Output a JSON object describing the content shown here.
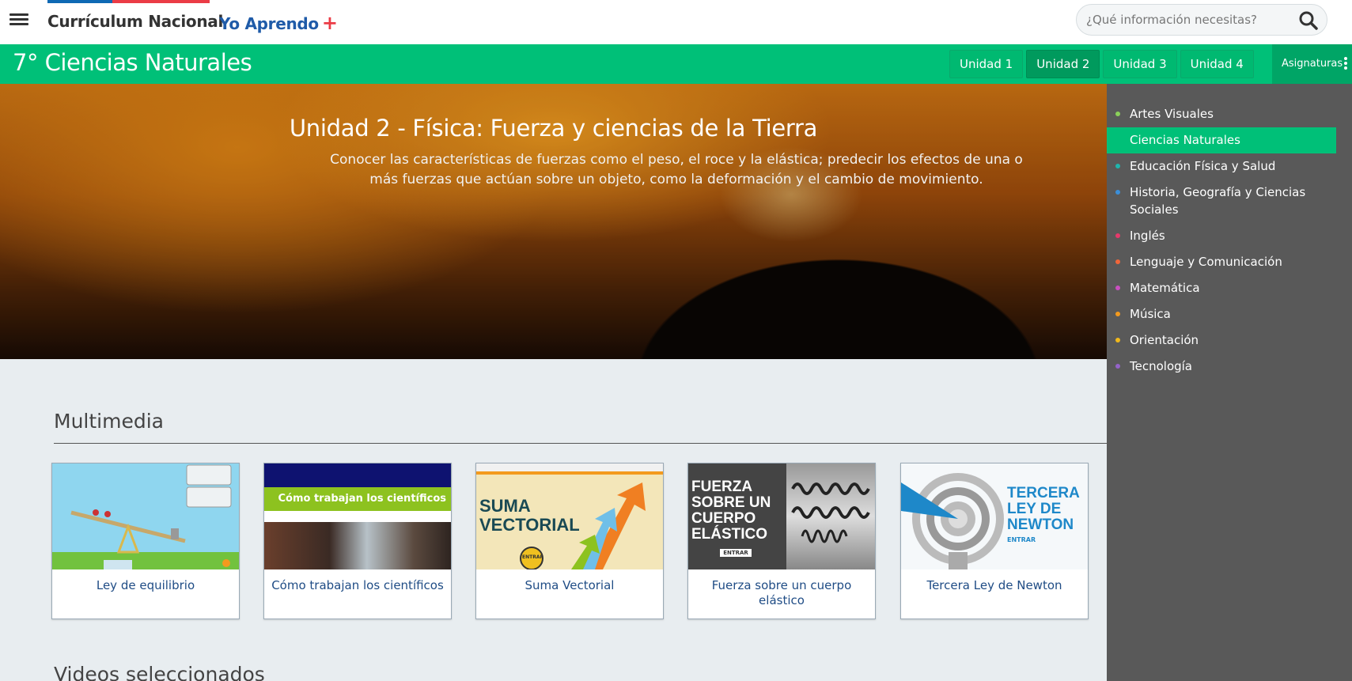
{
  "header": {
    "brand": "Currículum Nacional",
    "brand_secondary": "Yo Aprendo",
    "brand_plus": "+",
    "search_placeholder": "¿Qué información necesitas?"
  },
  "course": {
    "title": "7° Ciencias Naturales",
    "units": [
      {
        "label": "Unidad 1",
        "active": false
      },
      {
        "label": "Unidad 2",
        "active": true
      },
      {
        "label": "Unidad 3",
        "active": false
      },
      {
        "label": "Unidad 4",
        "active": false
      }
    ],
    "subjects_button": "Asignaturas"
  },
  "hero": {
    "title": "Unidad 2 - Física: Fuerza y ciencias de la Tierra",
    "description": "Conocer las características de fuerzas como el peso, el roce y la elástica; predecir los efectos de una o más fuerzas que actúan sobre un objeto, como la deformación y el cambio de movimiento."
  },
  "subjects": [
    {
      "label": "Artes Visuales",
      "color": "#8bd05a",
      "active": false
    },
    {
      "label": "Ciencias Naturales",
      "color": "#00c078",
      "active": true
    },
    {
      "label": "Educación Física y Salud",
      "color": "#1fb5ad",
      "active": false
    },
    {
      "label": "Historia, Geografía y Ciencias Sociales",
      "color": "#3b8fd9",
      "active": false
    },
    {
      "label": "Inglés",
      "color": "#e6396b",
      "active": false
    },
    {
      "label": "Lenguaje y Comunicación",
      "color": "#f0663a",
      "active": false
    },
    {
      "label": "Matemática",
      "color": "#c94fc0",
      "active": false
    },
    {
      "label": "Música",
      "color": "#f39a1e",
      "active": false
    },
    {
      "label": "Orientación",
      "color": "#f0b81c",
      "active": false
    },
    {
      "label": "Tecnología",
      "color": "#9463c9",
      "active": false
    }
  ],
  "multimedia": {
    "title": "Multimedia",
    "cards": [
      {
        "label": "Ley de equilibrio"
      },
      {
        "label": "Cómo trabajan los científicos",
        "thumb_text": "Cómo trabajan los científicos"
      },
      {
        "label": "Suma Vectorial",
        "thumb_text": "SUMA VECTORIAL",
        "thumb_button": "ENTRAR"
      },
      {
        "label": "Fuerza sobre un cuerpo elástico",
        "thumb_text": "FUERZA SOBRE UN CUERPO ELÁSTICO",
        "thumb_button": "ENTRAR"
      },
      {
        "label": "Tercera Ley de Newton",
        "thumb_text": "TERCERA LEY DE NEWTON",
        "thumb_button": "ENTRAR"
      }
    ]
  },
  "videos": {
    "title": "Videos seleccionados"
  }
}
